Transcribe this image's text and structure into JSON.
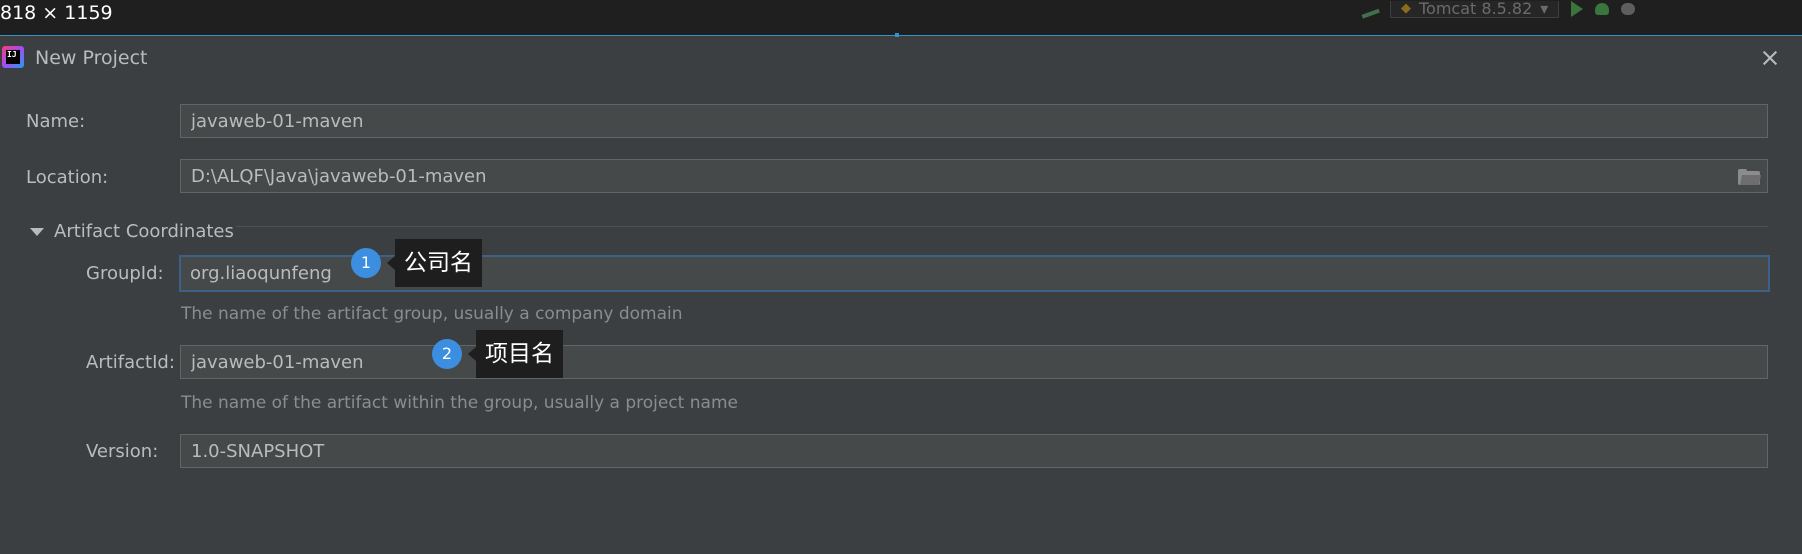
{
  "overlay": {
    "dimensions_label": "818 × 1159"
  },
  "ide_toolbar": {
    "run_config": "Tomcat 8.5.82"
  },
  "dialog": {
    "title": "New Project",
    "name": {
      "label": "Name:",
      "value": "javaweb-01-maven"
    },
    "location": {
      "label": "Location:",
      "value": "D:\\ALQF\\Java\\javaweb-01-maven"
    },
    "artifact_section": {
      "title": "Artifact Coordinates",
      "expanded": true,
      "group_id": {
        "label": "GroupId:",
        "value": "org.liaoqunfeng",
        "hint": "The name of the artifact group, usually a company domain"
      },
      "artifact_id": {
        "label": "ArtifactId:",
        "value": "javaweb-01-maven",
        "hint": "The name of the artifact within the group, usually a project name"
      },
      "version": {
        "label": "Version:",
        "value": "1.0-SNAPSHOT"
      }
    }
  },
  "annotations": [
    {
      "number": "1",
      "text": "公司名"
    },
    {
      "number": "2",
      "text": "项目名"
    }
  ],
  "colors": {
    "dialog_bg": "#3c3f41",
    "field_bg": "#45494a",
    "focus_border": "#3d6185",
    "badge": "#3c8ee0",
    "callout_bg": "#1e1e1e"
  }
}
